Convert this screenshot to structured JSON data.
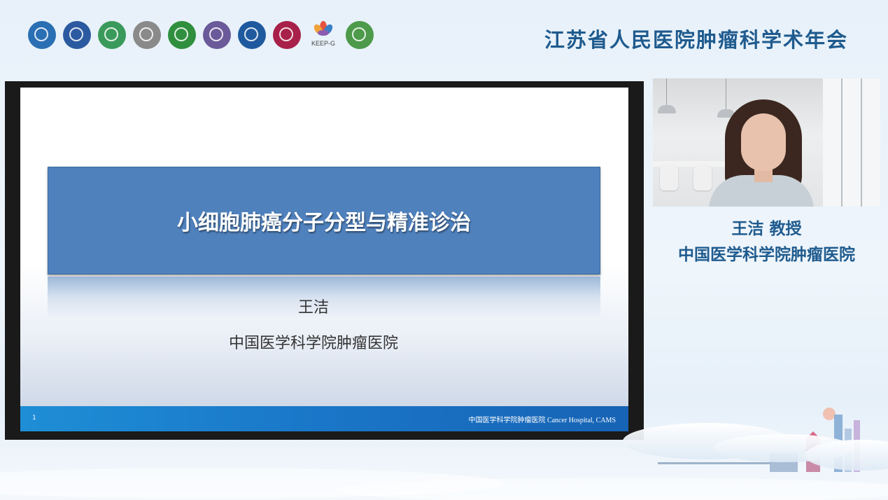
{
  "header": {
    "conference_title": "江苏省人民医院肿瘤科学术年会",
    "keep_logo_text": "KEEP-G",
    "logos": [
      {
        "icon": "society-logo-1-icon",
        "color": "#2a6fb3"
      },
      {
        "icon": "society-logo-2-icon",
        "color": "#2c5aa0"
      },
      {
        "icon": "medical-cross-logo-icon",
        "color": "#3a9a5b"
      },
      {
        "icon": "association-logo-icon",
        "color": "#5a5a5a"
      },
      {
        "icon": "green-emblem-logo-icon",
        "color": "#2f8f3e"
      },
      {
        "icon": "purple-seal-logo-icon",
        "color": "#6a5a9a"
      },
      {
        "icon": "blue-gear-logo-icon",
        "color": "#1f5a9e"
      },
      {
        "icon": "red-seal-logo-icon",
        "color": "#a8214a"
      },
      {
        "icon": "keep-g-flower-logo-icon",
        "color": "#d8473f"
      },
      {
        "icon": "green-circle-logo-icon",
        "color": "#4c9a4a"
      }
    ]
  },
  "slide": {
    "title": "小细胞肺癌分子分型与精准诊治",
    "author": "王洁",
    "institution": "中国医学科学院肿瘤医院",
    "page_number": "1",
    "footer_text": "中国医学科学院肿瘤医院  Cancer Hospital, CAMS"
  },
  "speaker": {
    "name": "王洁 教授",
    "institution": "中国医学科学院肿瘤医院"
  },
  "colors": {
    "title_blue": "#1f5b8e",
    "slide_title_box": "#4f81bd",
    "footer_blue": "#1a76c8"
  }
}
